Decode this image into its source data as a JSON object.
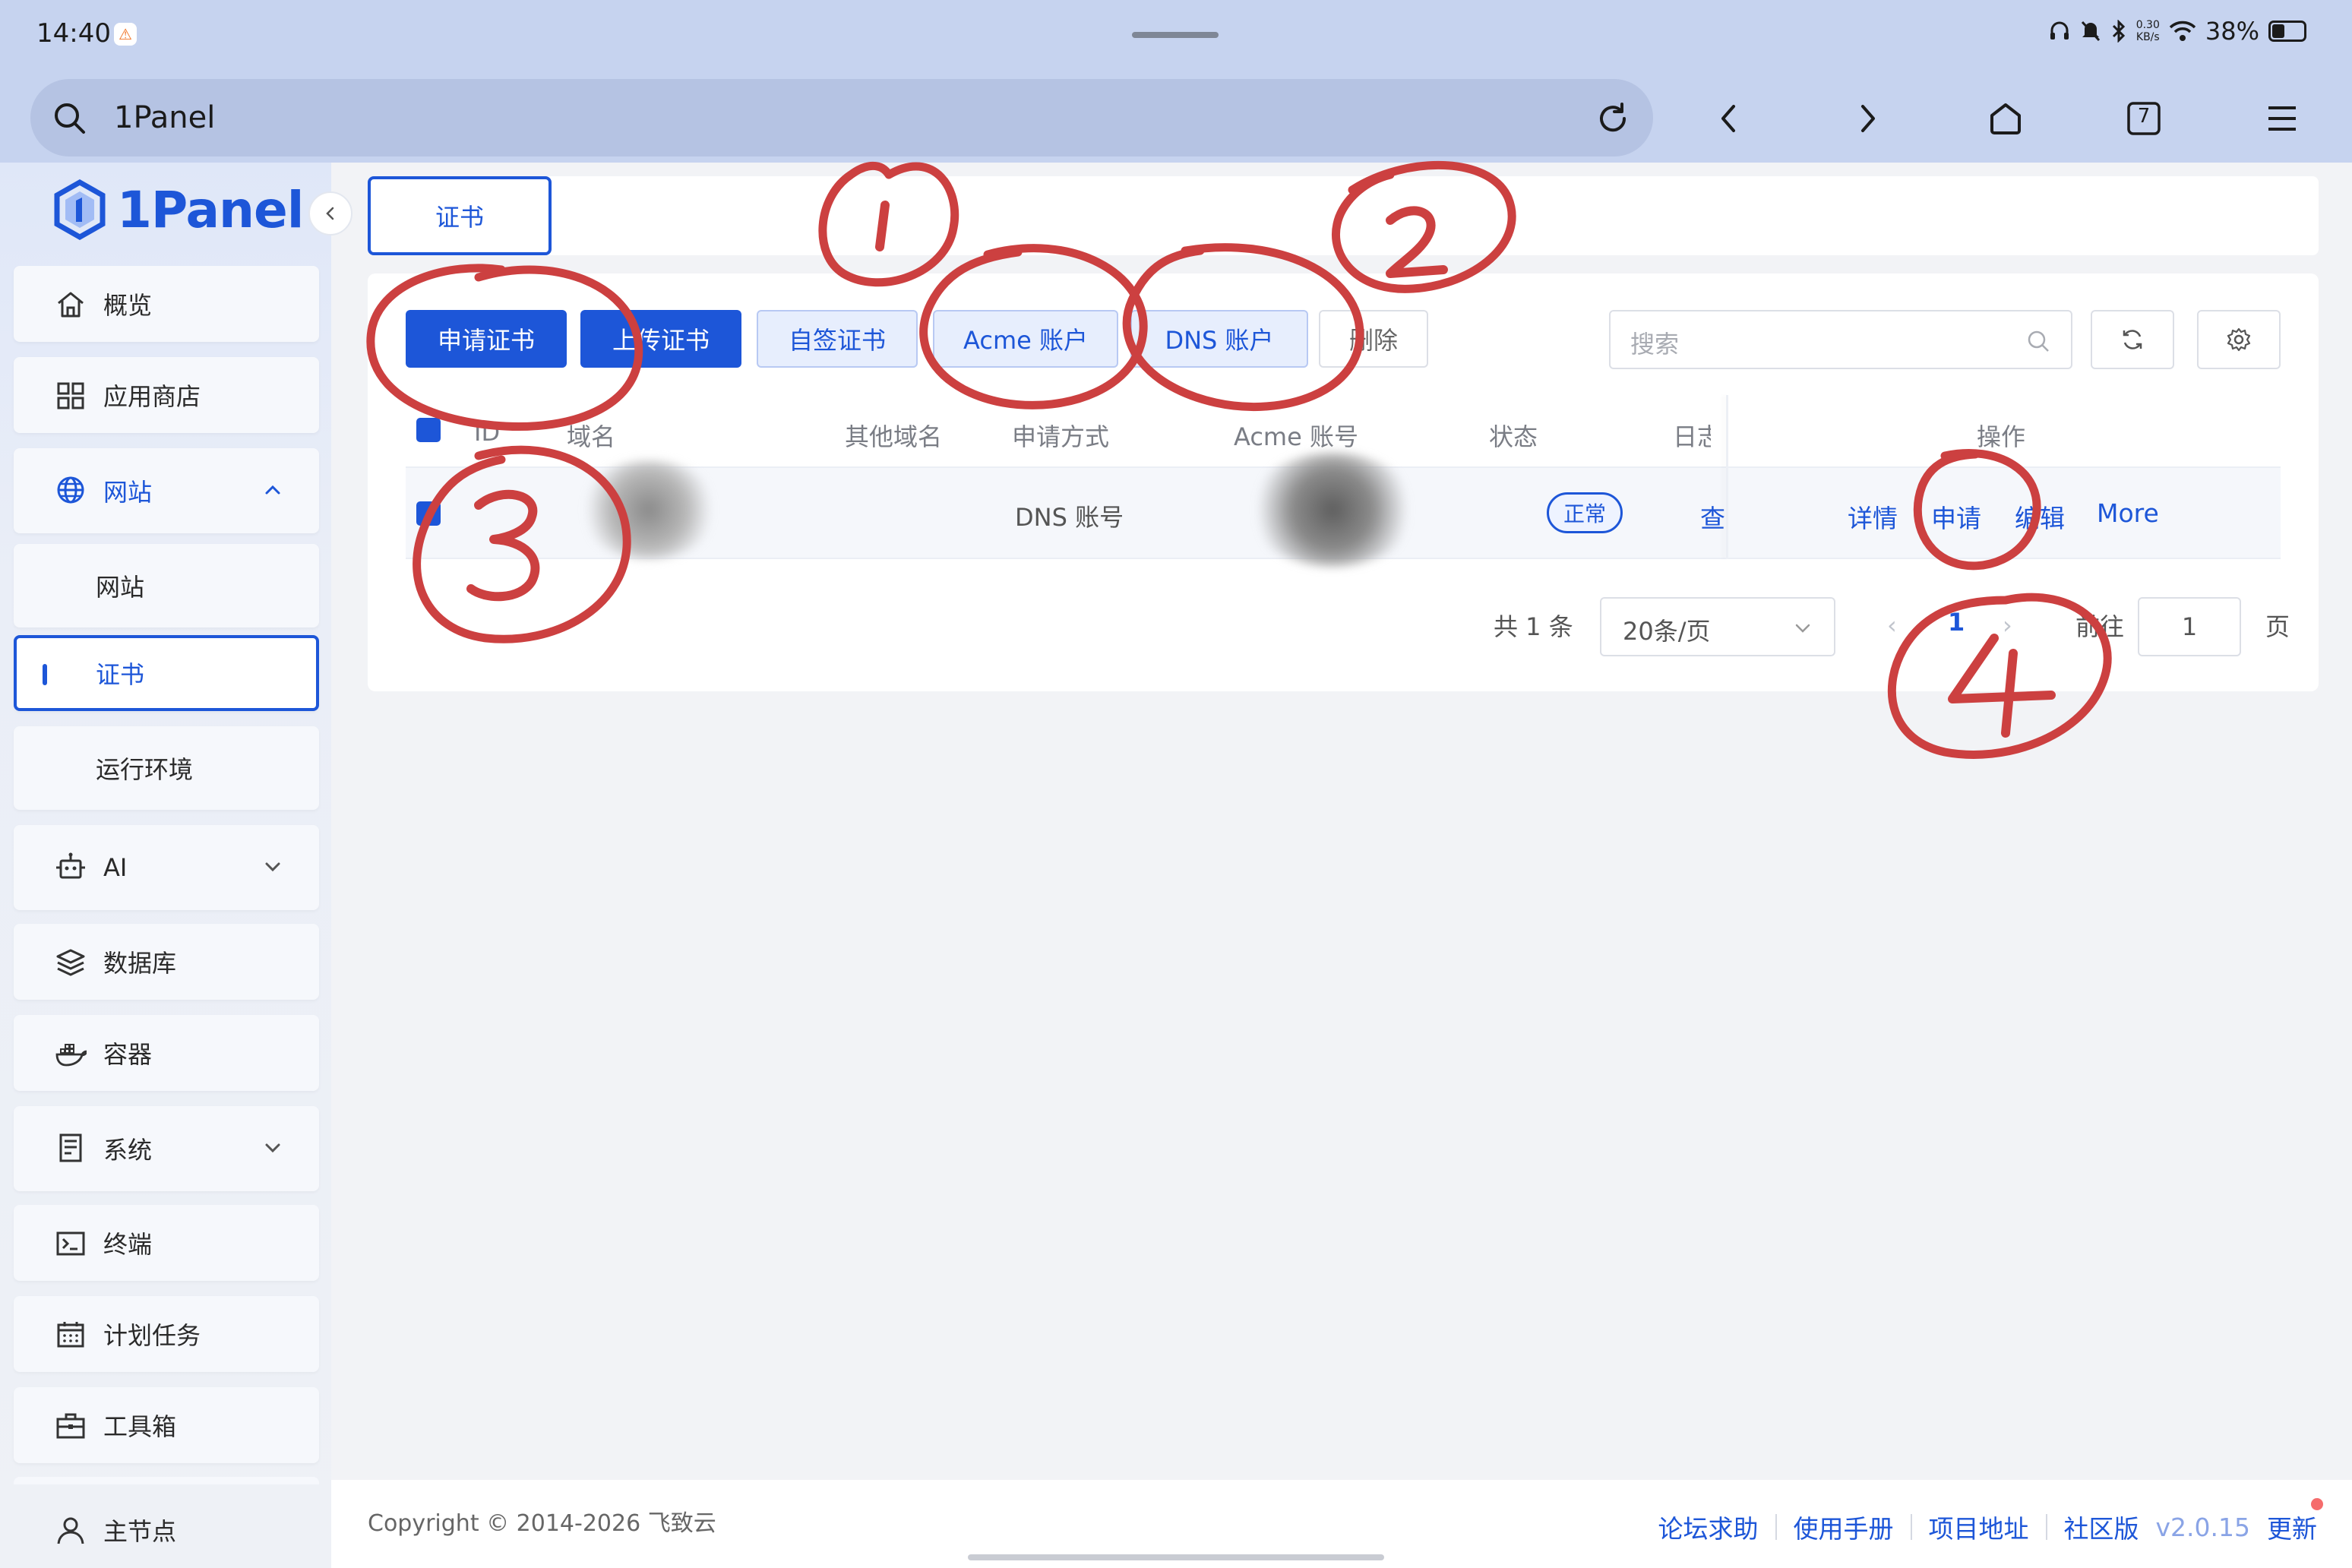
{
  "status_bar": {
    "time": "14:40",
    "network_speed_value": "0.30",
    "network_speed_unit": "KB/s",
    "battery": "38%",
    "icons": [
      "headphones-icon",
      "mute-icon",
      "bluetooth-icon",
      "wifi-icon",
      "battery-icon"
    ]
  },
  "browser": {
    "address": "1Panel",
    "tab_count": "7",
    "buttons": [
      "back-icon",
      "forward-icon",
      "home-icon",
      "tabs-icon",
      "menu-icon"
    ]
  },
  "sidebar": {
    "logo": "1Panel",
    "items": [
      {
        "label": "概览",
        "icon": "home-icon"
      },
      {
        "label": "应用商店",
        "icon": "grid-icon"
      },
      {
        "label": "网站",
        "icon": "globe-icon",
        "expanded": true
      },
      {
        "label": "网站"
      },
      {
        "label": "证书",
        "selected": true
      },
      {
        "label": "运行环境"
      },
      {
        "label": "AI",
        "icon": "robot-icon"
      },
      {
        "label": "数据库",
        "icon": "layers-icon"
      },
      {
        "label": "容器",
        "icon": "docker-icon"
      },
      {
        "label": "系统",
        "icon": "server-icon"
      },
      {
        "label": "终端",
        "icon": "terminal-icon"
      },
      {
        "label": "计划任务",
        "icon": "calendar-icon"
      },
      {
        "label": "工具箱",
        "icon": "toolbox-icon"
      }
    ],
    "node": {
      "label": "主节点",
      "icon": "user-icon"
    }
  },
  "tabs": {
    "active": "证书"
  },
  "toolbar": {
    "apply_cert": "申请证书",
    "upload_cert": "上传证书",
    "self_signed": "自签证书",
    "acme_account": "Acme 账户",
    "dns_account": "DNS 账户",
    "delete": "删除",
    "search_placeholder": "搜索"
  },
  "table": {
    "headers": [
      "ID",
      "域名",
      "其他域名",
      "申请方式",
      "Acme 账号",
      "状态",
      "日志",
      "操作"
    ],
    "rows": [
      {
        "apply_method": "DNS 账号",
        "status": "正常",
        "log": "查看",
        "actions": [
          "详情",
          "申请",
          "编辑",
          "More"
        ]
      }
    ]
  },
  "pagination": {
    "total": "共 1 条",
    "page_size": "20条/页",
    "current": "1",
    "goto_label": "前往",
    "goto_value": "1",
    "unit": "页"
  },
  "footer": {
    "copyright": "Copyright © 2014-2026 飞致云",
    "links": [
      "论坛求助",
      "使用手册",
      "项目地址",
      "社区版"
    ],
    "version": "v2.0.15",
    "update": "更新"
  },
  "annotations": {
    "labels": [
      "1",
      "2",
      "3",
      "3",
      "4"
    ],
    "color": "#cc4040"
  },
  "colors": {
    "accent": "#1d56d8",
    "chrome": "#c6d3ef",
    "annotation": "#cc4040"
  }
}
